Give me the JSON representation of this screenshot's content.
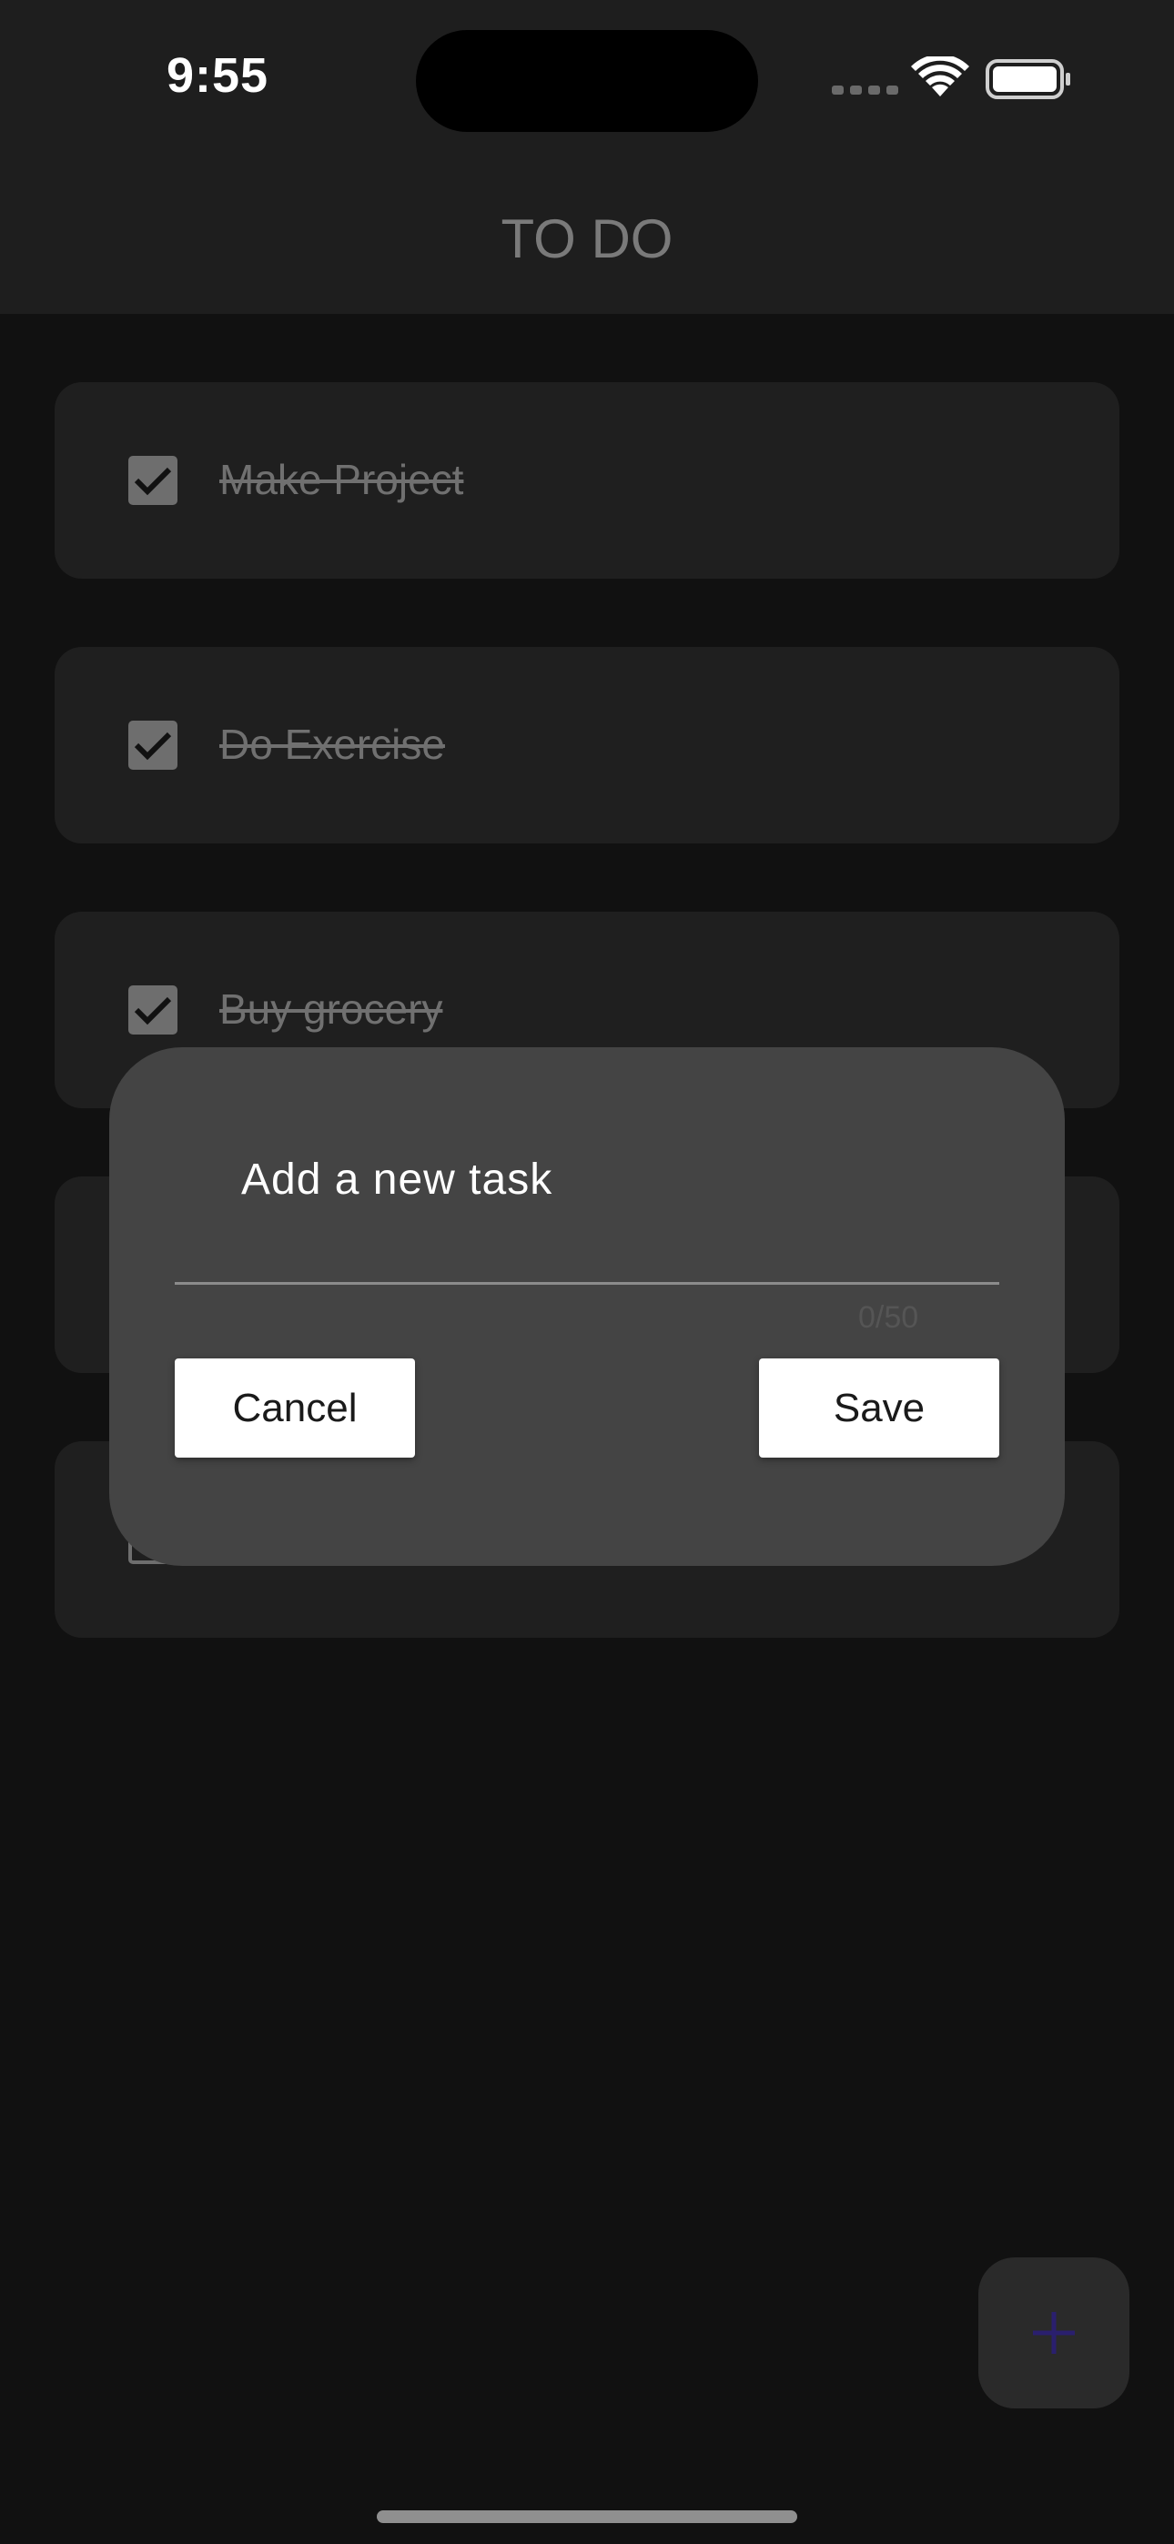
{
  "status_bar": {
    "time": "9:55",
    "wifi_icon": "wifi-icon",
    "battery_icon": "battery-icon",
    "signal_icon": "cellular-signal-icon"
  },
  "app_bar": {
    "title": "TO DO"
  },
  "tasks": [
    {
      "label": "Make Project",
      "completed": true
    },
    {
      "label": "Do Exercise",
      "completed": true
    },
    {
      "label": "Buy grocery",
      "completed": true
    },
    {
      "label": "",
      "completed": false
    },
    {
      "label": "",
      "completed": false
    }
  ],
  "dialog": {
    "input_value": "Add a new task",
    "counter": "0/50",
    "cancel_label": "Cancel",
    "save_label": "Save"
  },
  "fab": {
    "icon": "plus-icon"
  },
  "colors": {
    "background": "#111111",
    "app_bar": "#1e1e1e",
    "card": "#1f1f1f",
    "dialog": "#444444",
    "fab_icon": "#2a1f6e"
  }
}
